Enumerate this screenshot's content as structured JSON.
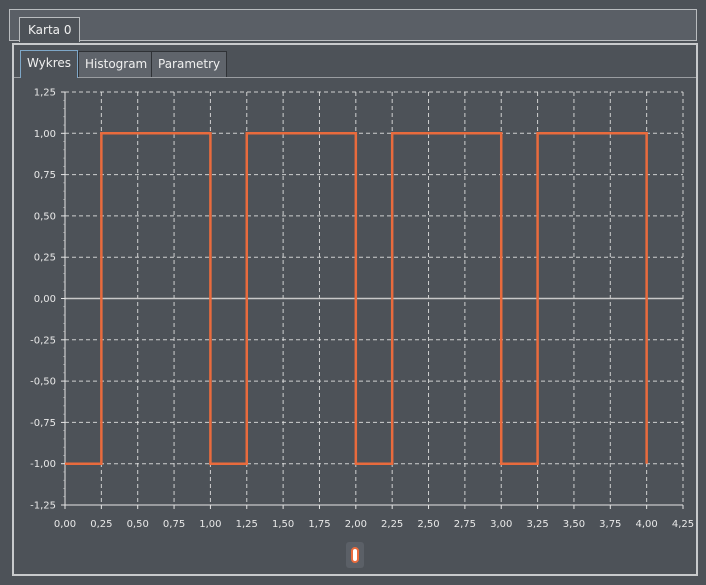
{
  "outer_tabs": [
    {
      "label": "Karta 0"
    }
  ],
  "inner_tabs": [
    {
      "label": "Wykres",
      "active": true
    },
    {
      "label": "Histogram",
      "active": false
    },
    {
      "label": "Parametry",
      "active": false
    }
  ],
  "colors": {
    "background": "#4d5258",
    "series": "#e96b3d",
    "grid": "#e6e6e6",
    "zero_line": "#c8c8c8"
  },
  "chart_data": {
    "type": "line",
    "title": "",
    "xlabel": "",
    "ylabel": "",
    "xlim": [
      0,
      4.25
    ],
    "ylim": [
      -1.25,
      1.25
    ],
    "grid": true,
    "x_ticks": [
      "0,00",
      "0,25",
      "0,50",
      "0,75",
      "1,00",
      "1,25",
      "1,50",
      "1,75",
      "2,00",
      "2,25",
      "2,50",
      "2,75",
      "3,00",
      "3,25",
      "3,50",
      "3,75",
      "4,00",
      "4,25"
    ],
    "y_ticks": [
      "1,25",
      "1,00",
      "0,75",
      "0,50",
      "0,25",
      "0,00",
      "-0,25",
      "-0,50",
      "-0,75",
      "-1,00",
      "-1,25"
    ],
    "series": [
      {
        "x": [
          0,
          0.25,
          0.25,
          1.0,
          1.0,
          1.25,
          1.25,
          2.0,
          2.0,
          2.25,
          2.25,
          3.0,
          3.0,
          3.25,
          3.25,
          4.0,
          4.0
        ],
        "y": [
          -1,
          -1,
          1,
          1,
          -1,
          -1,
          1,
          1,
          -1,
          -1,
          1,
          1,
          -1,
          -1,
          1,
          1,
          -1
        ]
      }
    ]
  }
}
